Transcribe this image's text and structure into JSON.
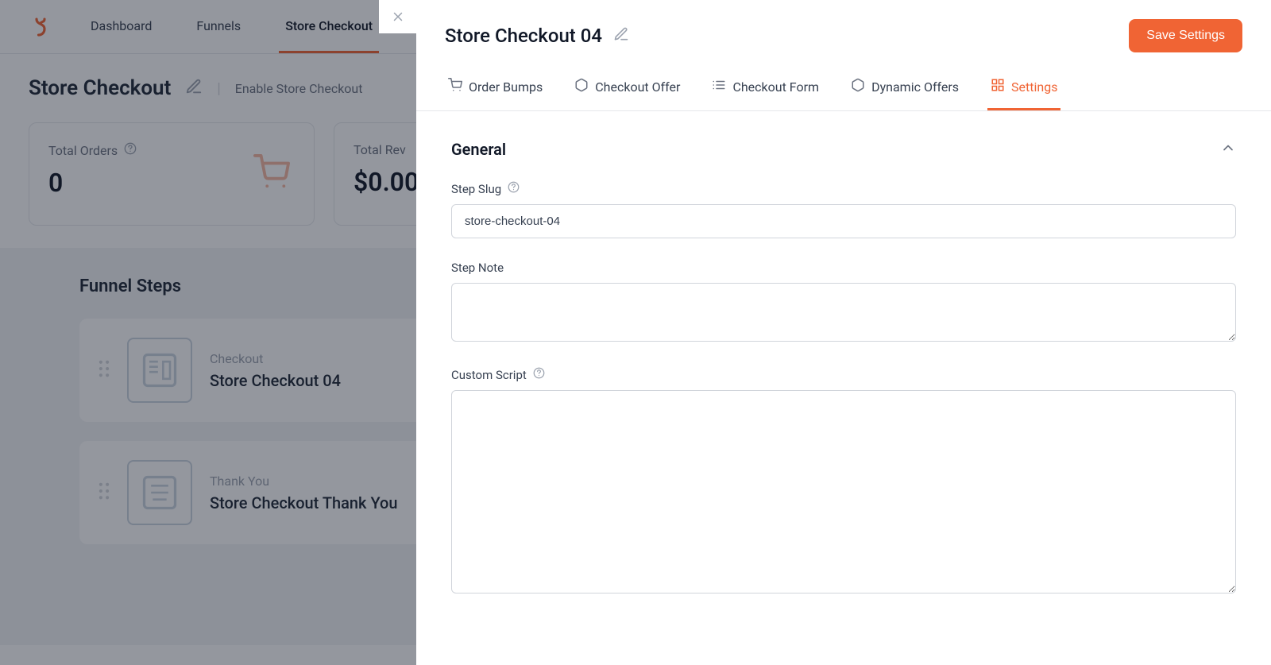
{
  "nav": {
    "items": [
      "Dashboard",
      "Funnels",
      "Store Checkout"
    ]
  },
  "header": {
    "title": "Store Checkout",
    "enable": "Enable Store Checkout"
  },
  "stats": {
    "orders_label": "Total Orders",
    "orders_value": "0",
    "revenue_label_partial": "Total Rev",
    "revenue_value": "$0.00"
  },
  "funnel": {
    "heading": "Funnel Steps",
    "steps": [
      {
        "type": "Checkout",
        "name": "Store Checkout 04"
      },
      {
        "type": "Thank You",
        "name": "Store Checkout Thank You"
      }
    ]
  },
  "panel": {
    "title": "Store Checkout 04",
    "save": "Save Settings",
    "tabs": {
      "order_bumps": "Order Bumps",
      "checkout_offer": "Checkout Offer",
      "checkout_form": "Checkout Form",
      "dynamic_offers": "Dynamic Offers",
      "settings": "Settings"
    },
    "section": {
      "general": "General"
    },
    "fields": {
      "slug_label": "Step Slug",
      "slug_value": "store-checkout-04",
      "note_label": "Step Note",
      "note_value": "",
      "script_label": "Custom Script",
      "script_value": ""
    }
  },
  "colors": {
    "accent": "#f06434"
  }
}
